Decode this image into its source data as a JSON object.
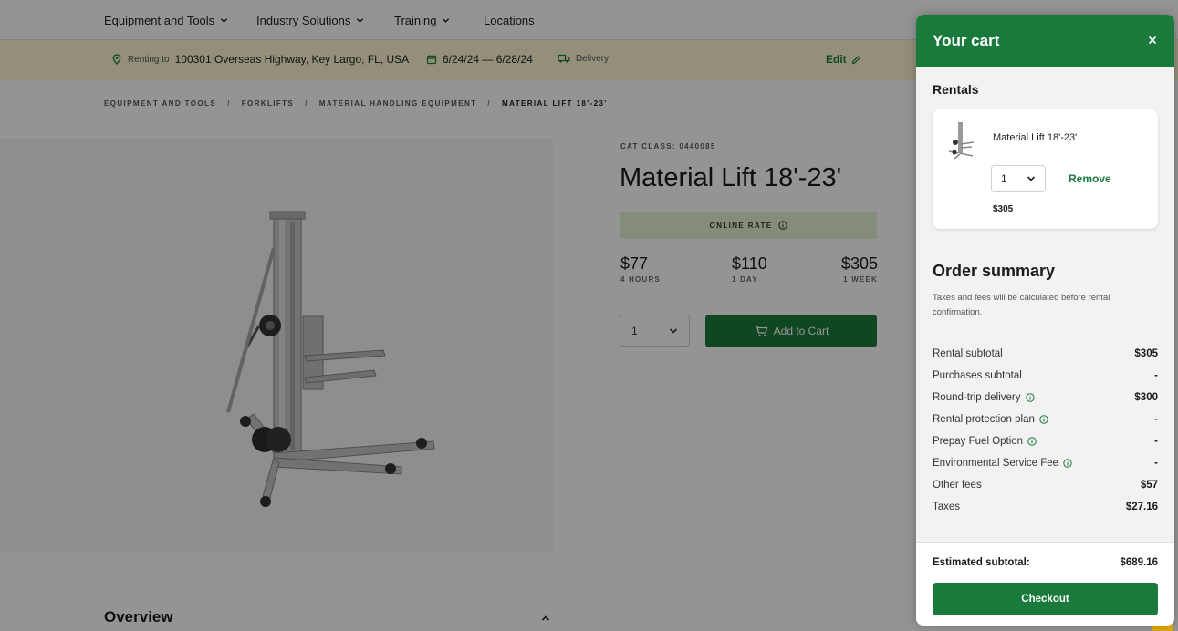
{
  "nav": {
    "items": [
      {
        "label": "Equipment and Tools"
      },
      {
        "label": "Industry Solutions"
      },
      {
        "label": "Training"
      },
      {
        "label": "Locations"
      }
    ]
  },
  "context": {
    "renting_prefix": "Renting to",
    "address": "100301 Overseas Highway, Key Largo, FL, USA",
    "dates": "6/24/24 — 6/28/24",
    "delivery": "Delivery",
    "edit": "Edit"
  },
  "breadcrumb": {
    "items": [
      "EQUIPMENT AND TOOLS",
      "FORKLIFTS",
      "MATERIAL HANDLING EQUIPMENT",
      "MATERIAL LIFT 18'-23'"
    ],
    "separator": "/"
  },
  "product": {
    "cat_class": "CAT CLASS: 0440085",
    "title": "Material Lift 18'-23'",
    "online_rate": "ONLINE RATE",
    "prices": [
      {
        "amount": "$77",
        "period": "4 HOURS"
      },
      {
        "amount": "$110",
        "period": "1 DAY"
      },
      {
        "amount": "$305",
        "period": "1 WEEK"
      }
    ],
    "quantity": "1",
    "add_to_cart": "Add to Cart"
  },
  "overview": {
    "title": "Overview"
  },
  "cart": {
    "title": "Your cart",
    "rentals_heading": "Rentals",
    "item": {
      "name": "Material Lift 18'-23'",
      "quantity": "1",
      "remove": "Remove",
      "price": "$305"
    },
    "summary": {
      "heading": "Order summary",
      "note": "Taxes and fees will be calculated before rental confirmation.",
      "rows": [
        {
          "label": "Rental subtotal",
          "value": "$305"
        },
        {
          "label": "Purchases subtotal",
          "value": "-"
        },
        {
          "label": "Round-trip delivery",
          "value": "$300"
        },
        {
          "label": "Rental protection plan",
          "value": "-"
        },
        {
          "label": "Prepay Fuel Option",
          "value": "-"
        },
        {
          "label": "Environmental Service Fee",
          "value": "-"
        },
        {
          "label": "Other fees",
          "value": "$57"
        },
        {
          "label": "Taxes",
          "value": "$27.16"
        }
      ]
    },
    "estimated_label": "Estimated subtotal:",
    "estimated_value": "$689.16",
    "checkout": "Checkout"
  },
  "colors": {
    "brand_green": "#1a7a3c",
    "rate_bg": "#e3f1d4",
    "context_bar": "#fff6d2",
    "overlay": "rgba(0,0,0,0.42)"
  },
  "icons": [
    "chevron-down-icon",
    "location-pin-icon",
    "calendar-icon",
    "truck-icon",
    "pencil-icon",
    "info-icon",
    "cart-icon",
    "close-icon",
    "chevron-up-icon"
  ]
}
